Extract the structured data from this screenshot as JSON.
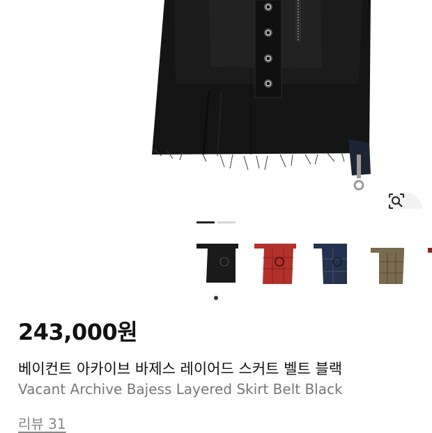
{
  "gallery": {
    "main_image": "layered-skirt-black-photo",
    "lens_icon": "lens-search-icon",
    "page_indicator": {
      "total": 2,
      "current": 1
    },
    "thumbnails": [
      {
        "color": "black",
        "hex": "#1a1a1a"
      },
      {
        "color": "red",
        "hex": "#b3312b"
      },
      {
        "color": "navy",
        "hex": "#24324f"
      },
      {
        "color": "brown check",
        "hex": "#7a6a4e"
      },
      {
        "color": "red (cut off)",
        "hex": "#8b2a26"
      }
    ],
    "selected_thumbnail": 1
  },
  "product": {
    "price": "243,000원",
    "title_ko": "베이컨트 아카이브 바제스 레이어드 스커트 벨트 블랙",
    "title_en": "Vacant Archive Bajess Layered Skirt Belt Black",
    "reviews_label": "리뷰 31"
  }
}
